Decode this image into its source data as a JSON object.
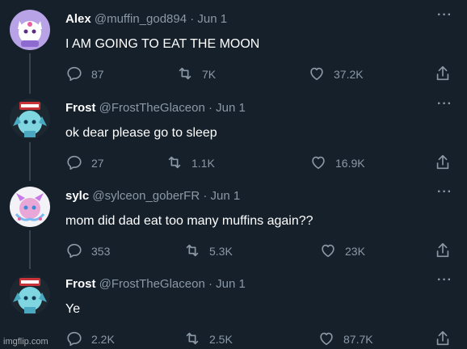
{
  "tweets": [
    {
      "name": "Alex",
      "handle": "@muffin_god894",
      "date": "Jun 1",
      "text": "I AM GOING TO EAT THE MOON",
      "replies": "87",
      "retweets": "7K",
      "likes": "37.2K"
    },
    {
      "name": "Frost",
      "handle": "@FrostTheGlaceon",
      "date": "Jun 1",
      "text": "ok dear please go to sleep",
      "replies": "27",
      "retweets": "1.1K",
      "likes": "16.9K"
    },
    {
      "name": "sylc",
      "handle": "@sylceon_goberFR",
      "date": "Jun 1",
      "text": "mom did dad eat too many muffins again??",
      "replies": "353",
      "retweets": "5.3K",
      "likes": "23K"
    },
    {
      "name": "Frost",
      "handle": "@FrostTheGlaceon",
      "date": "Jun 1",
      "text": "Ye",
      "replies": "2.2K",
      "retweets": "2.5K",
      "likes": "87.7K"
    }
  ],
  "separator": "·",
  "more": "···",
  "watermark": "imgflip.com",
  "colors": {
    "background": "#15202b",
    "text": "#ffffff",
    "muted": "#8b98a5",
    "thread_line": "#38444d"
  },
  "icons": [
    "reply-icon",
    "retweet-icon",
    "like-icon",
    "share-icon",
    "more-icon"
  ]
}
